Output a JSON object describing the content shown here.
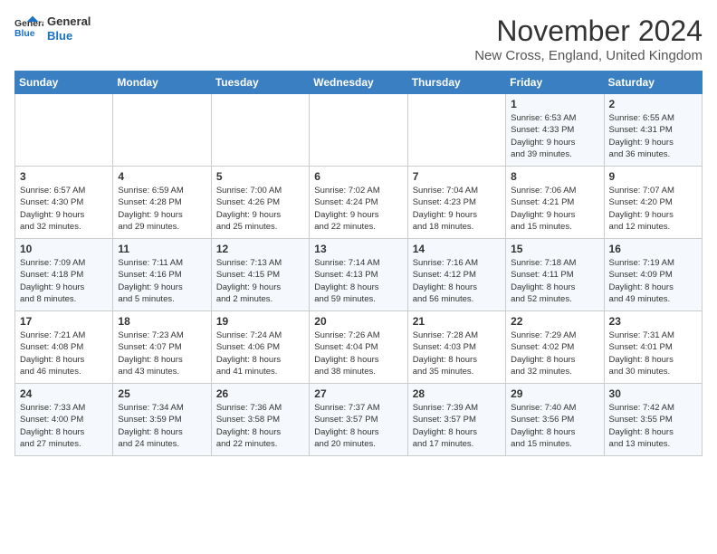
{
  "logo": {
    "line1": "General",
    "line2": "Blue"
  },
  "title": "November 2024",
  "subtitle": "New Cross, England, United Kingdom",
  "days_of_week": [
    "Sunday",
    "Monday",
    "Tuesday",
    "Wednesday",
    "Thursday",
    "Friday",
    "Saturday"
  ],
  "weeks": [
    [
      {
        "day": "",
        "info": ""
      },
      {
        "day": "",
        "info": ""
      },
      {
        "day": "",
        "info": ""
      },
      {
        "day": "",
        "info": ""
      },
      {
        "day": "",
        "info": ""
      },
      {
        "day": "1",
        "info": "Sunrise: 6:53 AM\nSunset: 4:33 PM\nDaylight: 9 hours\nand 39 minutes."
      },
      {
        "day": "2",
        "info": "Sunrise: 6:55 AM\nSunset: 4:31 PM\nDaylight: 9 hours\nand 36 minutes."
      }
    ],
    [
      {
        "day": "3",
        "info": "Sunrise: 6:57 AM\nSunset: 4:30 PM\nDaylight: 9 hours\nand 32 minutes."
      },
      {
        "day": "4",
        "info": "Sunrise: 6:59 AM\nSunset: 4:28 PM\nDaylight: 9 hours\nand 29 minutes."
      },
      {
        "day": "5",
        "info": "Sunrise: 7:00 AM\nSunset: 4:26 PM\nDaylight: 9 hours\nand 25 minutes."
      },
      {
        "day": "6",
        "info": "Sunrise: 7:02 AM\nSunset: 4:24 PM\nDaylight: 9 hours\nand 22 minutes."
      },
      {
        "day": "7",
        "info": "Sunrise: 7:04 AM\nSunset: 4:23 PM\nDaylight: 9 hours\nand 18 minutes."
      },
      {
        "day": "8",
        "info": "Sunrise: 7:06 AM\nSunset: 4:21 PM\nDaylight: 9 hours\nand 15 minutes."
      },
      {
        "day": "9",
        "info": "Sunrise: 7:07 AM\nSunset: 4:20 PM\nDaylight: 9 hours\nand 12 minutes."
      }
    ],
    [
      {
        "day": "10",
        "info": "Sunrise: 7:09 AM\nSunset: 4:18 PM\nDaylight: 9 hours\nand 8 minutes."
      },
      {
        "day": "11",
        "info": "Sunrise: 7:11 AM\nSunset: 4:16 PM\nDaylight: 9 hours\nand 5 minutes."
      },
      {
        "day": "12",
        "info": "Sunrise: 7:13 AM\nSunset: 4:15 PM\nDaylight: 9 hours\nand 2 minutes."
      },
      {
        "day": "13",
        "info": "Sunrise: 7:14 AM\nSunset: 4:13 PM\nDaylight: 8 hours\nand 59 minutes."
      },
      {
        "day": "14",
        "info": "Sunrise: 7:16 AM\nSunset: 4:12 PM\nDaylight: 8 hours\nand 56 minutes."
      },
      {
        "day": "15",
        "info": "Sunrise: 7:18 AM\nSunset: 4:11 PM\nDaylight: 8 hours\nand 52 minutes."
      },
      {
        "day": "16",
        "info": "Sunrise: 7:19 AM\nSunset: 4:09 PM\nDaylight: 8 hours\nand 49 minutes."
      }
    ],
    [
      {
        "day": "17",
        "info": "Sunrise: 7:21 AM\nSunset: 4:08 PM\nDaylight: 8 hours\nand 46 minutes."
      },
      {
        "day": "18",
        "info": "Sunrise: 7:23 AM\nSunset: 4:07 PM\nDaylight: 8 hours\nand 43 minutes."
      },
      {
        "day": "19",
        "info": "Sunrise: 7:24 AM\nSunset: 4:06 PM\nDaylight: 8 hours\nand 41 minutes."
      },
      {
        "day": "20",
        "info": "Sunrise: 7:26 AM\nSunset: 4:04 PM\nDaylight: 8 hours\nand 38 minutes."
      },
      {
        "day": "21",
        "info": "Sunrise: 7:28 AM\nSunset: 4:03 PM\nDaylight: 8 hours\nand 35 minutes."
      },
      {
        "day": "22",
        "info": "Sunrise: 7:29 AM\nSunset: 4:02 PM\nDaylight: 8 hours\nand 32 minutes."
      },
      {
        "day": "23",
        "info": "Sunrise: 7:31 AM\nSunset: 4:01 PM\nDaylight: 8 hours\nand 30 minutes."
      }
    ],
    [
      {
        "day": "24",
        "info": "Sunrise: 7:33 AM\nSunset: 4:00 PM\nDaylight: 8 hours\nand 27 minutes."
      },
      {
        "day": "25",
        "info": "Sunrise: 7:34 AM\nSunset: 3:59 PM\nDaylight: 8 hours\nand 24 minutes."
      },
      {
        "day": "26",
        "info": "Sunrise: 7:36 AM\nSunset: 3:58 PM\nDaylight: 8 hours\nand 22 minutes."
      },
      {
        "day": "27",
        "info": "Sunrise: 7:37 AM\nSunset: 3:57 PM\nDaylight: 8 hours\nand 20 minutes."
      },
      {
        "day": "28",
        "info": "Sunrise: 7:39 AM\nSunset: 3:57 PM\nDaylight: 8 hours\nand 17 minutes."
      },
      {
        "day": "29",
        "info": "Sunrise: 7:40 AM\nSunset: 3:56 PM\nDaylight: 8 hours\nand 15 minutes."
      },
      {
        "day": "30",
        "info": "Sunrise: 7:42 AM\nSunset: 3:55 PM\nDaylight: 8 hours\nand 13 minutes."
      }
    ]
  ]
}
